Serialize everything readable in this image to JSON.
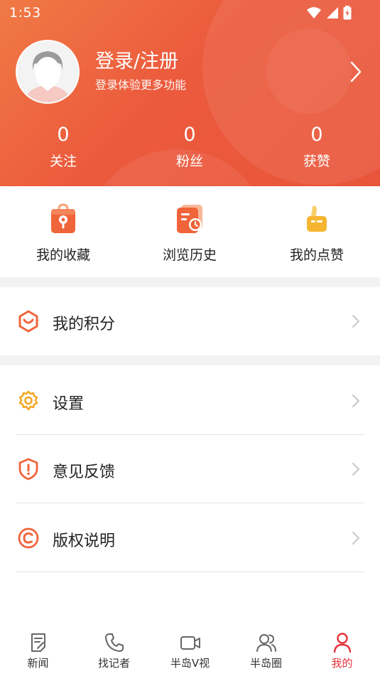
{
  "status_bar": {
    "time": "1:53"
  },
  "profile": {
    "title": "登录/注册",
    "subtitle": "登录体验更多功能"
  },
  "stats": [
    {
      "value": "0",
      "label": "关注"
    },
    {
      "value": "0",
      "label": "粉丝"
    },
    {
      "value": "0",
      "label": "获赞"
    }
  ],
  "quick_actions": [
    {
      "label": "我的收藏",
      "icon": "favorites-bag-icon"
    },
    {
      "label": "浏览历史",
      "icon": "history-clock-icon"
    },
    {
      "label": "我的点赞",
      "icon": "thumbs-up-icon"
    }
  ],
  "menu": [
    {
      "label": "我的积分",
      "icon": "points-hexagon-icon"
    },
    {
      "label": "设置",
      "icon": "settings-gear-icon"
    },
    {
      "label": "意见反馈",
      "icon": "feedback-shield-icon"
    },
    {
      "label": "版权说明",
      "icon": "copyright-icon"
    }
  ],
  "bottom_nav": [
    {
      "label": "新闻",
      "icon": "news-icon"
    },
    {
      "label": "找记者",
      "icon": "phone-icon"
    },
    {
      "label": "半岛V视",
      "icon": "video-icon"
    },
    {
      "label": "半岛圈",
      "icon": "community-icon"
    },
    {
      "label": "我的",
      "icon": "profile-icon",
      "active": true
    }
  ],
  "colors": {
    "header_start": "#f07a45",
    "header_end": "#e9553a",
    "accent_red": "#e6313b",
    "icon_orange": "#f0643a",
    "icon_yellow": "#f5b531"
  }
}
